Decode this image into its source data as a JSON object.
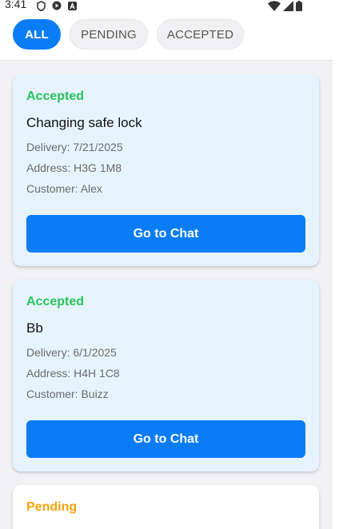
{
  "status_bar": {
    "time": "3:41",
    "left_icons": [
      "shield-icon",
      "play-protect-icon",
      "a-app-icon"
    ],
    "right_icons": [
      "wifi-icon",
      "signal-icon",
      "battery-icon"
    ]
  },
  "filters": {
    "selected": "ALL",
    "all_label": "ALL",
    "pending_label": "PENDING",
    "accepted_label": "ACCEPTED"
  },
  "colors": {
    "accent": "#0a7cf6",
    "accepted_status": "#28c45a",
    "pending_status": "#f5a00b",
    "accepted_card_bg": "#e6f3fd",
    "pending_card_bg": "#ffffff"
  },
  "requests": [
    {
      "status": "Accepted",
      "title": "Changing safe lock",
      "delivery": "Delivery: 7/21/2025",
      "address": "Address: H3G 1M8",
      "customer": "Customer: Alex",
      "action": "Go to Chat"
    },
    {
      "status": "Accepted",
      "title": "Bb",
      "delivery": "Delivery: 6/1/2025",
      "address": "Address: H4H 1C8",
      "customer": "Customer: Buizz",
      "action": "Go to Chat"
    },
    {
      "status": "Pending"
    }
  ]
}
